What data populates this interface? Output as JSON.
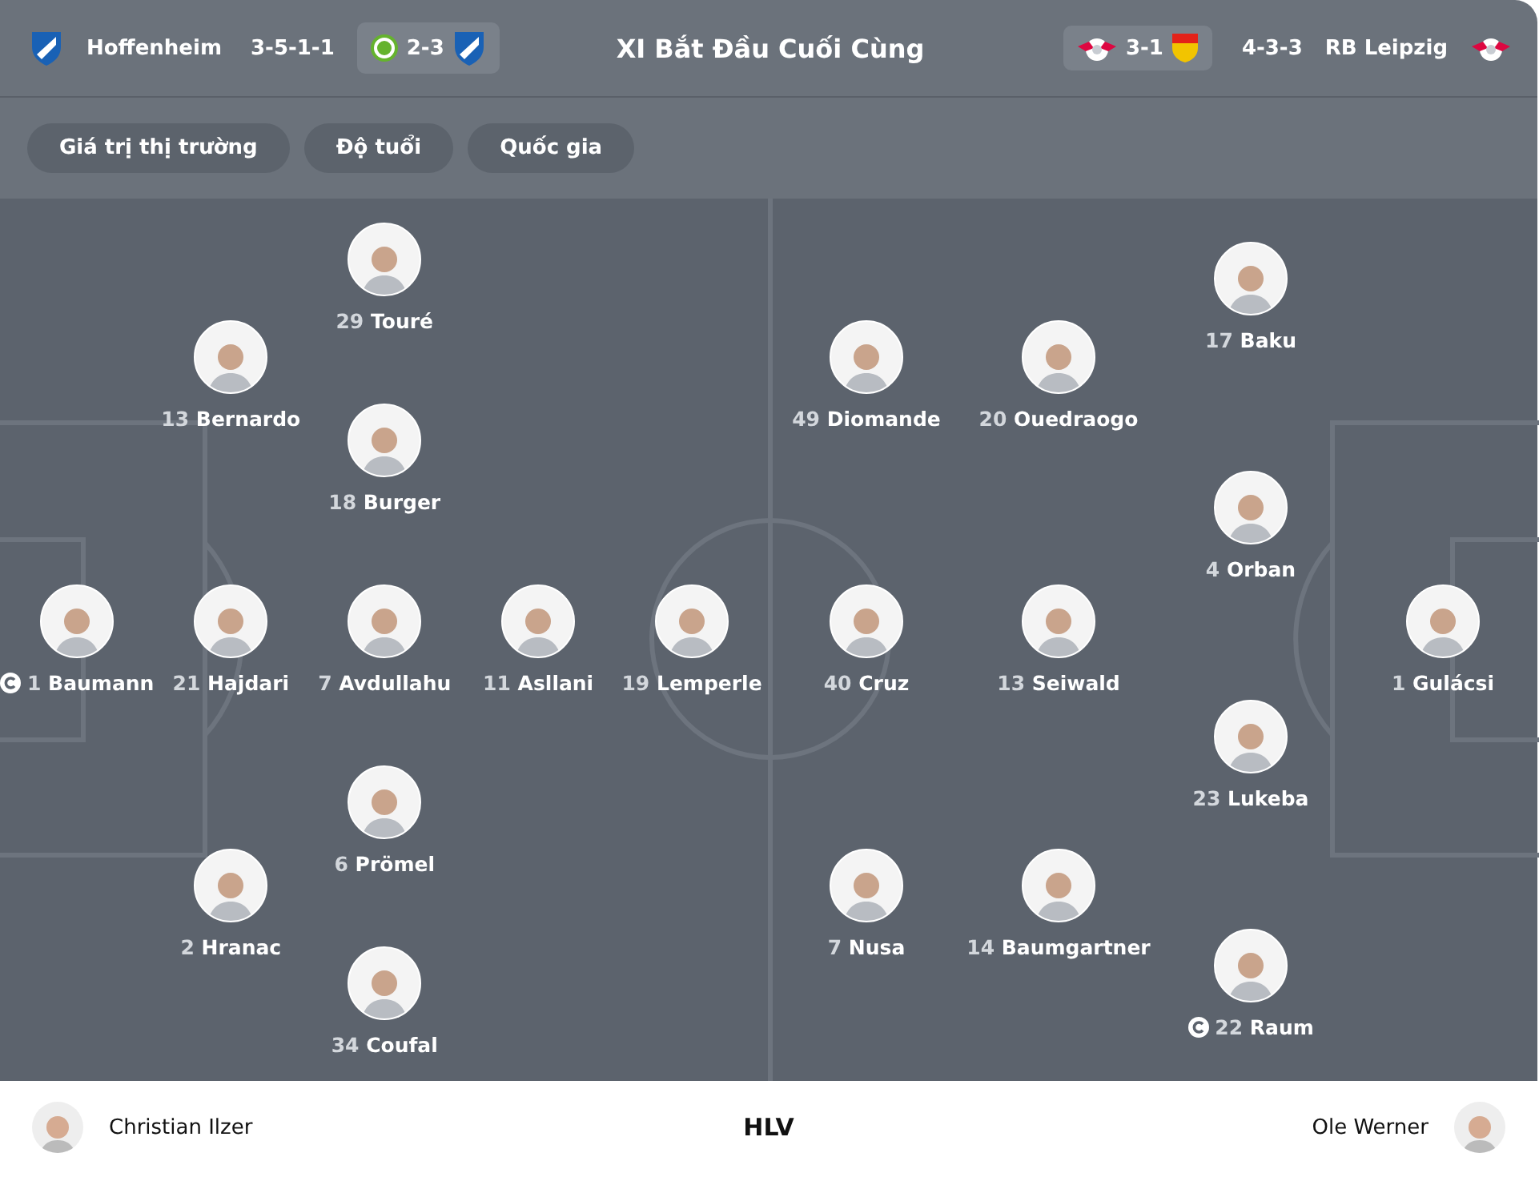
{
  "header": {
    "title": "XI Bắt Đầu Cuối Cùng",
    "home": {
      "name": "Hoffenheim",
      "formation": "3-5-1-1",
      "last_result": "2-3"
    },
    "away": {
      "name": "RB Leipzig",
      "formation": "4-3-3",
      "last_result": "3-1"
    }
  },
  "filters": [
    {
      "label": "Giá trị thị trường"
    },
    {
      "label": "Độ tuổi"
    },
    {
      "label": "Quốc gia"
    }
  ],
  "pitch": {
    "home_lines": [
      [
        {
          "number": "1",
          "name": "Baumann",
          "captain": true
        }
      ],
      [
        {
          "number": "13",
          "name": "Bernardo",
          "captain": false
        },
        {
          "number": "21",
          "name": "Hajdari",
          "captain": false
        },
        {
          "number": "2",
          "name": "Hranac",
          "captain": false
        }
      ],
      [
        {
          "number": "29",
          "name": "Touré",
          "captain": false
        },
        {
          "number": "18",
          "name": "Burger",
          "captain": false
        },
        {
          "number": "7",
          "name": "Avdullahu",
          "captain": false
        },
        {
          "number": "6",
          "name": "Prömel",
          "captain": false
        },
        {
          "number": "34",
          "name": "Coufal",
          "captain": false
        }
      ],
      [
        {
          "number": "11",
          "name": "Asllani",
          "captain": false
        }
      ],
      [
        {
          "number": "19",
          "name": "Lemperle",
          "captain": false
        }
      ]
    ],
    "away_lines": [
      [
        {
          "number": "49",
          "name": "Diomande",
          "captain": false
        },
        {
          "number": "40",
          "name": "Cruz",
          "captain": false
        },
        {
          "number": "7",
          "name": "Nusa",
          "captain": false
        }
      ],
      [
        {
          "number": "20",
          "name": "Ouedraogo",
          "captain": false
        },
        {
          "number": "13",
          "name": "Seiwald",
          "captain": false
        },
        {
          "number": "14",
          "name": "Baumgartner",
          "captain": false
        }
      ],
      [
        {
          "number": "17",
          "name": "Baku",
          "captain": false
        },
        {
          "number": "4",
          "name": "Orban",
          "captain": false
        },
        {
          "number": "23",
          "name": "Lukeba",
          "captain": false
        },
        {
          "number": "22",
          "name": "Raum",
          "captain": true
        }
      ],
      [
        {
          "number": "1",
          "name": "Gulácsi",
          "captain": false
        }
      ]
    ]
  },
  "coaches": {
    "home": "Christian Ilzer",
    "label": "HLV",
    "away": "Ole Werner"
  }
}
